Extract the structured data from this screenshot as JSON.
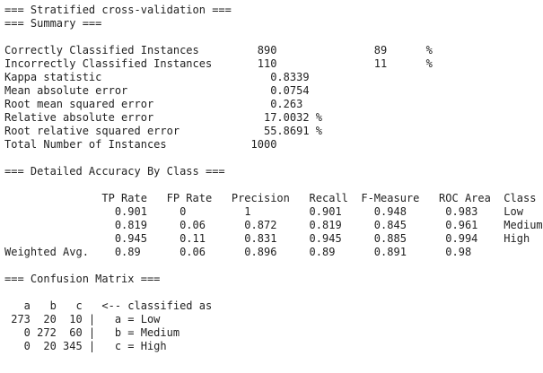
{
  "output": {
    "lines": [
      "=== Stratified cross-validation ===",
      "=== Summary ===",
      "",
      "Correctly Classified Instances         890               89      %",
      "Incorrectly Classified Instances       110               11      %",
      "Kappa statistic                          0.8339",
      "Mean absolute error                      0.0754",
      "Root mean squared error                  0.263",
      "Relative absolute error                 17.0032 %",
      "Root relative squared error             55.8691 %",
      "Total Number of Instances             1000",
      "",
      "=== Detailed Accuracy By Class ===",
      "",
      "               TP Rate   FP Rate   Precision   Recall  F-Measure   ROC Area  Class",
      "                 0.901     0         1         0.901     0.948      0.983    Low",
      "                 0.819     0.06      0.872     0.819     0.845      0.961    Medium",
      "                 0.945     0.11      0.831     0.945     0.885      0.994    High",
      "Weighted Avg.    0.89      0.06      0.896     0.89      0.891      0.98",
      "",
      "=== Confusion Matrix ===",
      "",
      "   a   b   c   <-- classified as",
      " 273  20  10 |   a = Low",
      "   0 272  60 |   b = Medium",
      "   0  20 345 |   c = High"
    ]
  }
}
